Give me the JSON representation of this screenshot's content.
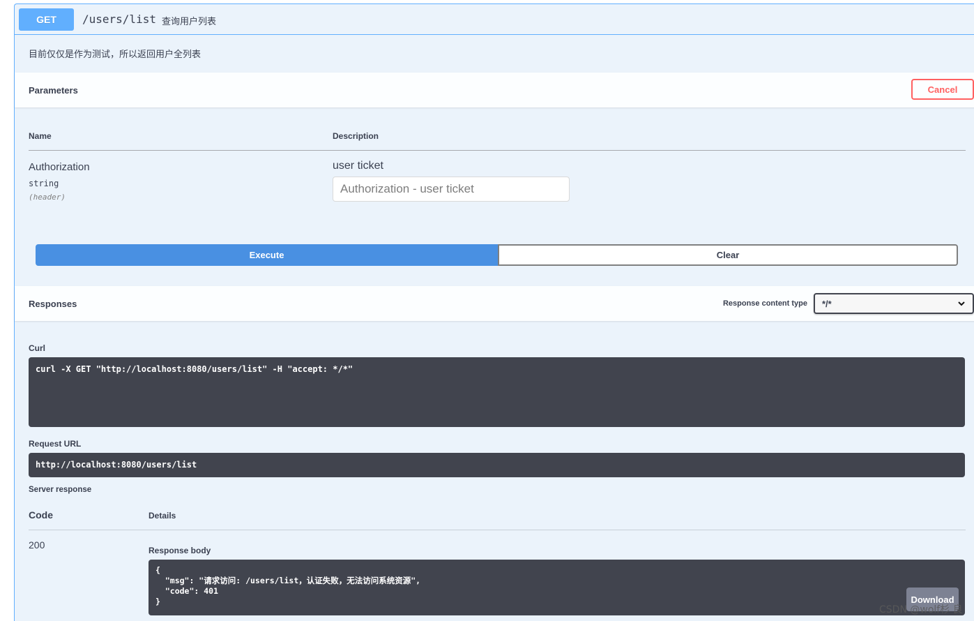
{
  "operation": {
    "method": "GET",
    "path": "/users/list",
    "summary": "查询用户列表",
    "description": "目前仅仅是作为测试，所以返回用户全列表"
  },
  "parameters": {
    "title": "Parameters",
    "cancel_label": "Cancel",
    "columns": {
      "name": "Name",
      "description": "Description"
    },
    "items": [
      {
        "name": "Authorization",
        "type": "string",
        "in": "(header)",
        "description": "user ticket",
        "placeholder": "Authorization - user ticket",
        "value": ""
      }
    ]
  },
  "actions": {
    "execute_label": "Execute",
    "clear_label": "Clear"
  },
  "responses": {
    "title": "Responses",
    "content_type_label": "Response content type",
    "content_type_value": "*/*",
    "curl_label": "Curl",
    "curl_command": "curl -X GET \"http://localhost:8080/users/list\" -H \"accept: */*\"",
    "request_url_label": "Request URL",
    "request_url": "http://localhost:8080/users/list",
    "server_response_label": "Server response",
    "code_header": "Code",
    "details_header": "Details",
    "status_code": "200",
    "body_label": "Response body",
    "body": "{\n  \"msg\": \"请求访问: /users/list，认证失败，无法访问系统资源\",\n  \"code\": 401\n}",
    "download_label": "Download"
  },
  "watermark": "CSDN @wolf杉 良",
  "colors": {
    "get_blue": "#61affe",
    "execute_blue": "#4990e2",
    "cancel_red": "#ff6060",
    "code_bg": "#41444e"
  }
}
